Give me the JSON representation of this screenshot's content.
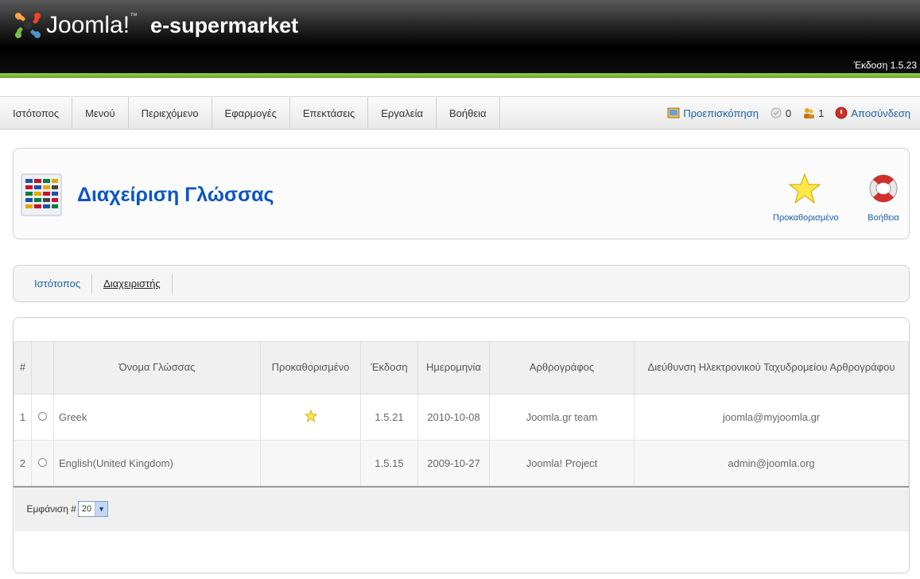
{
  "header": {
    "logo_text": "Joomla!",
    "site_name": "e-supermarket",
    "version": "Έκδοση 1.5.23"
  },
  "menu": {
    "items": [
      "Ιστότοπος",
      "Μενού",
      "Περιεχόμενο",
      "Εφαρμογές",
      "Επεκτάσεις",
      "Εργαλεία",
      "Βοήθεια"
    ]
  },
  "status": {
    "preview": "Προεπισκόπηση",
    "messages": "0",
    "users": "1",
    "logout": "Αποσύνδεση"
  },
  "toolbar": {
    "title": "Διαχείριση Γλώσσας",
    "default_label": "Προκαθορισμένο",
    "help_label": "Βοήθεια"
  },
  "submenu": {
    "items": [
      "Ιστότοπος",
      "Διαχειριστής"
    ],
    "active": "Διαχειριστής"
  },
  "table": {
    "headers": {
      "num": "#",
      "name": "Όνομα Γλώσσας",
      "default": "Προκαθορισμένο",
      "version": "Έκδοση",
      "date": "Ημερομηνία",
      "author": "Αρθρογράφος",
      "email": "Διεύθυνση Ηλεκτρονικού Ταχυδρομείου Αρθρογράφου"
    },
    "rows": [
      {
        "num": "1",
        "name": "Greek",
        "default": true,
        "version": "1.5.21",
        "date": "2010-10-08",
        "author": "Joomla.gr team",
        "email": "joomla@myjoomla.gr"
      },
      {
        "num": "2",
        "name": "English(United Kingdom)",
        "default": false,
        "version": "1.5.15",
        "date": "2009-10-27",
        "author": "Joomla! Project",
        "email": "admin@joomla.org"
      }
    ]
  },
  "footer": {
    "display_label": "Εμφάνιση #",
    "limit_value": "20"
  },
  "colors": {
    "accent_green": "#6aa629",
    "link_blue": "#1a5fa8",
    "title_blue": "#0b55c4"
  }
}
